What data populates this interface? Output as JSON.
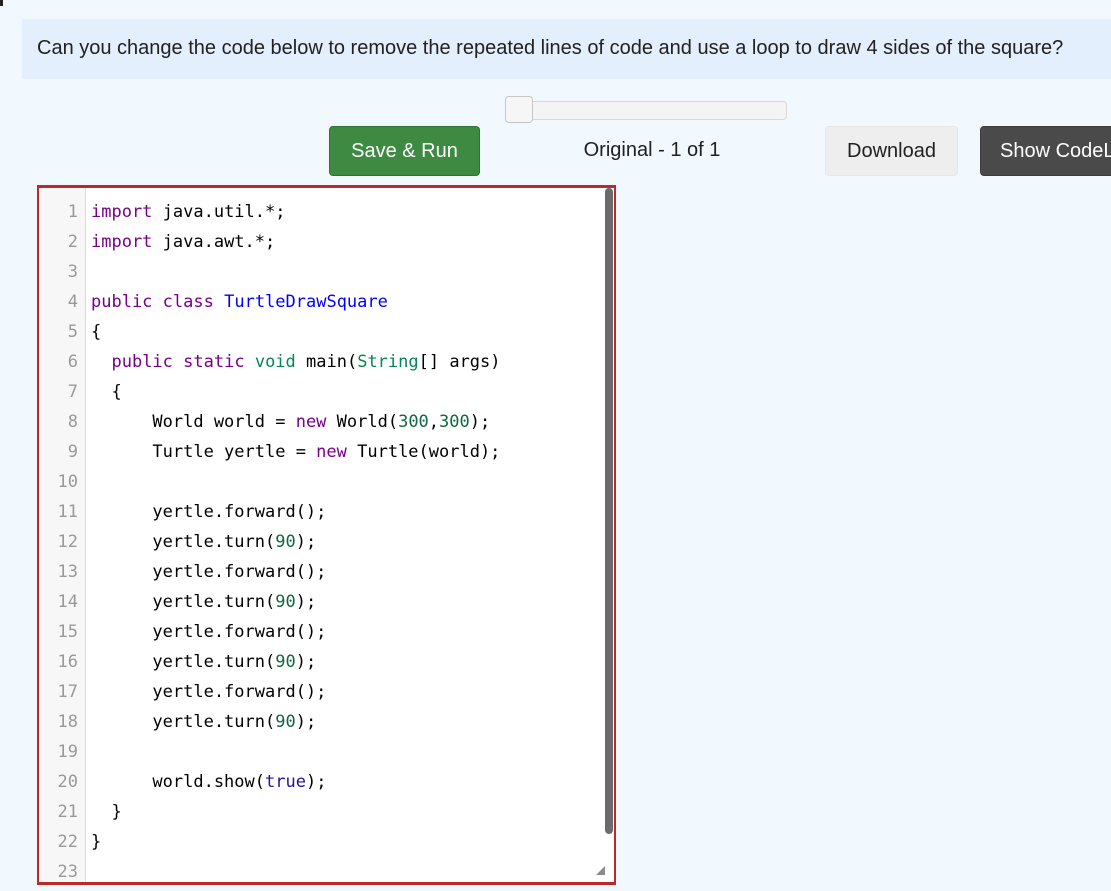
{
  "prompt": {
    "text": "Can you change the code below to remove the repeated lines of code and use a loop to draw 4 sides of the square?"
  },
  "toolbar": {
    "run_label": "Save & Run",
    "version_label": "Original - 1 of 1",
    "download_label": "Download",
    "show_label": "Show CodeLens"
  },
  "editor": {
    "language": "java",
    "lines": [
      [
        [
          "import",
          "keyword"
        ],
        [
          " java.util.*;",
          "plain"
        ]
      ],
      [
        [
          "import",
          "keyword"
        ],
        [
          " java.awt.*;",
          "plain"
        ]
      ],
      [],
      [
        [
          "public",
          "keyword"
        ],
        [
          " ",
          "plain"
        ],
        [
          "class",
          "keyword"
        ],
        [
          " ",
          "plain"
        ],
        [
          "TurtleDrawSquare",
          "def"
        ]
      ],
      [
        [
          "{",
          "plain"
        ]
      ],
      [
        [
          "  ",
          "plain"
        ],
        [
          "public",
          "keyword"
        ],
        [
          " ",
          "plain"
        ],
        [
          "static",
          "keyword"
        ],
        [
          " ",
          "plain"
        ],
        [
          "void",
          "type"
        ],
        [
          " main(",
          "plain"
        ],
        [
          "String",
          "type"
        ],
        [
          "[] args)",
          "plain"
        ]
      ],
      [
        [
          "  {",
          "plain"
        ]
      ],
      [
        [
          "      World world = ",
          "plain"
        ],
        [
          "new",
          "keyword"
        ],
        [
          " World(",
          "plain"
        ],
        [
          "300",
          "number"
        ],
        [
          ",",
          "plain"
        ],
        [
          "300",
          "number"
        ],
        [
          ");",
          "plain"
        ]
      ],
      [
        [
          "      Turtle yertle = ",
          "plain"
        ],
        [
          "new",
          "keyword"
        ],
        [
          " Turtle(world);",
          "plain"
        ]
      ],
      [],
      [
        [
          "      yertle.forward();",
          "plain"
        ]
      ],
      [
        [
          "      yertle.turn(",
          "plain"
        ],
        [
          "90",
          "number"
        ],
        [
          ");",
          "plain"
        ]
      ],
      [
        [
          "      yertle.forward();",
          "plain"
        ]
      ],
      [
        [
          "      yertle.turn(",
          "plain"
        ],
        [
          "90",
          "number"
        ],
        [
          ");",
          "plain"
        ]
      ],
      [
        [
          "      yertle.forward();",
          "plain"
        ]
      ],
      [
        [
          "      yertle.turn(",
          "plain"
        ],
        [
          "90",
          "number"
        ],
        [
          ");",
          "plain"
        ]
      ],
      [
        [
          "      yertle.forward();",
          "plain"
        ]
      ],
      [
        [
          "      yertle.turn(",
          "plain"
        ],
        [
          "90",
          "number"
        ],
        [
          ");",
          "plain"
        ]
      ],
      [],
      [
        [
          "      world.show(",
          "plain"
        ],
        [
          "true",
          "atom"
        ],
        [
          ");",
          "plain"
        ]
      ],
      [
        [
          "  }",
          "plain"
        ]
      ],
      [
        [
          "}",
          "plain"
        ]
      ],
      []
    ]
  }
}
